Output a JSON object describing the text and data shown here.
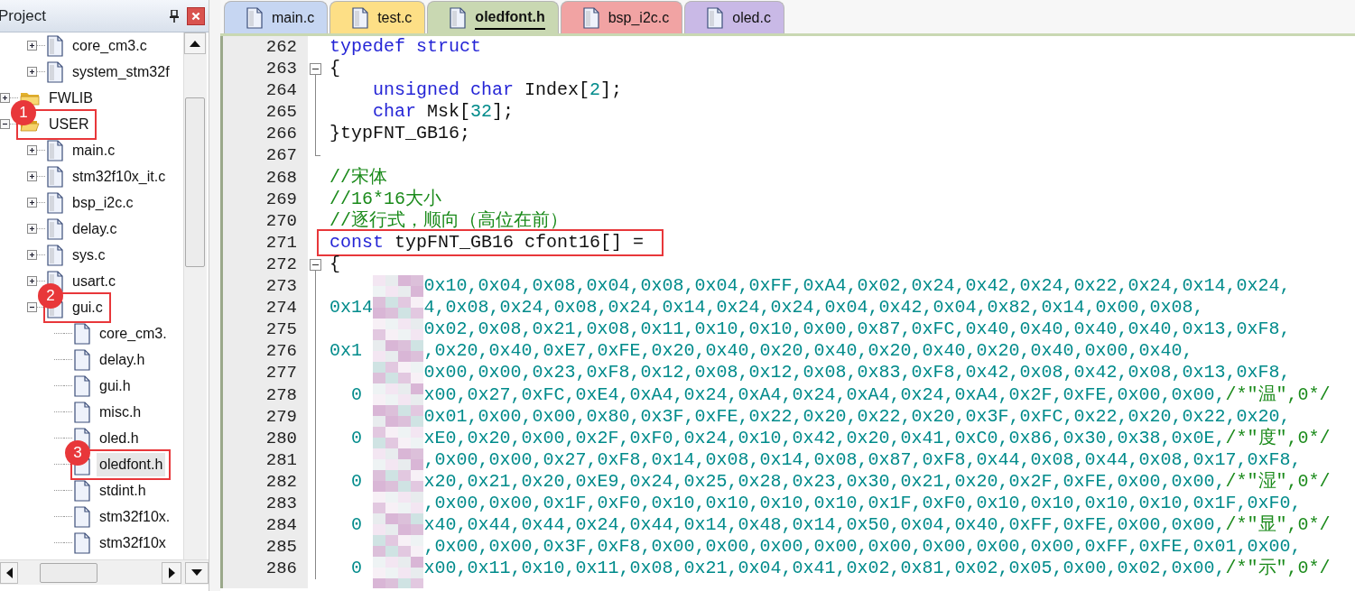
{
  "panel": {
    "title": "Project"
  },
  "tree": [
    {
      "children": [
        {
          "name": "core_cm3.c",
          "kind": "source",
          "expanded": false,
          "selected": false,
          "highlighted": false
        },
        {
          "name": "system_stm32f",
          "kind": "source",
          "expanded": false,
          "selected": false,
          "highlighted": false
        }
      ]
    },
    {
      "name": "FWLIB",
      "kind": "folder",
      "expanded": false,
      "selected": false,
      "highlighted": false
    },
    {
      "name": "USER",
      "kind": "folder",
      "expanded": true,
      "selected": false,
      "highlighted": true,
      "marker": "1",
      "children": [
        {
          "name": "main.c",
          "kind": "source",
          "expanded": false,
          "selected": false,
          "highlighted": false
        },
        {
          "name": "stm32f10x_it.c",
          "kind": "source",
          "expanded": false,
          "selected": false,
          "highlighted": false
        },
        {
          "name": "bsp_i2c.c",
          "kind": "source",
          "expanded": false,
          "selected": false,
          "highlighted": false
        },
        {
          "name": "delay.c",
          "kind": "source",
          "expanded": false,
          "selected": false,
          "highlighted": false
        },
        {
          "name": "sys.c",
          "kind": "source",
          "expanded": false,
          "selected": false,
          "highlighted": false
        },
        {
          "name": "usart.c",
          "kind": "source",
          "expanded": false,
          "selected": false,
          "highlighted": false
        },
        {
          "name": "gui.c",
          "kind": "source",
          "expanded": true,
          "selected": false,
          "highlighted": true,
          "marker": "2",
          "children": [
            {
              "name": "core_cm3.",
              "kind": "header",
              "selected": false,
              "highlighted": false
            },
            {
              "name": "delay.h",
              "kind": "header",
              "selected": false,
              "highlighted": false
            },
            {
              "name": "gui.h",
              "kind": "header",
              "selected": false,
              "highlighted": false
            },
            {
              "name": "misc.h",
              "kind": "header",
              "selected": false,
              "highlighted": false
            },
            {
              "name": "oled.h",
              "kind": "header",
              "selected": false,
              "highlighted": false
            },
            {
              "name": "oledfont.h",
              "kind": "header",
              "selected": true,
              "highlighted": true,
              "marker": "3"
            },
            {
              "name": "stdint.h",
              "kind": "header",
              "selected": false,
              "highlighted": false
            },
            {
              "name": "stm32f10x.",
              "kind": "header",
              "selected": false,
              "highlighted": false
            },
            {
              "name": "stm32f10x",
              "kind": "header",
              "selected": false,
              "highlighted": false
            }
          ]
        }
      ]
    }
  ],
  "tabs": [
    {
      "label": "main.c",
      "color": "#c6d6f2",
      "selected": false
    },
    {
      "label": "test.c",
      "color": "#fddf86",
      "selected": false
    },
    {
      "label": "oledfont.h",
      "color": "#c9d8b2",
      "selected": true
    },
    {
      "label": "bsp_i2c.c",
      "color": "#f1a3a3",
      "selected": false
    },
    {
      "label": "oled.c",
      "color": "#c9b9e6",
      "selected": false
    }
  ],
  "code_lines": [
    {
      "number": "262",
      "kind": "plain",
      "highlighted": false,
      "tokens": [
        {
          "kind": "keyword",
          "text": "typedef"
        },
        {
          "kind": "keyword",
          "text": " struct"
        }
      ]
    },
    {
      "number": "263",
      "kind": "opener",
      "highlighted": false,
      "tokens": [
        {
          "kind": "plain",
          "text": "{"
        }
      ]
    },
    {
      "number": "264",
      "kind": "body",
      "highlighted": false,
      "tokens": [
        {
          "kind": "keyword",
          "text": "    unsigned"
        },
        {
          "kind": "keyword",
          "text": " char"
        },
        {
          "kind": "plain",
          "text": " Index["
        },
        {
          "kind": "number",
          "text": "2"
        },
        {
          "kind": "plain",
          "text": "];"
        }
      ]
    },
    {
      "number": "265",
      "kind": "body",
      "highlighted": false,
      "tokens": [
        {
          "kind": "keyword",
          "text": "    char"
        },
        {
          "kind": "plain",
          "text": " Msk["
        },
        {
          "kind": "number",
          "text": "32"
        },
        {
          "kind": "plain",
          "text": "];"
        }
      ]
    },
    {
      "number": "266",
      "kind": "body",
      "highlighted": false,
      "tokens": [
        {
          "kind": "plain",
          "text": "}typFNT_GB16;"
        }
      ]
    },
    {
      "number": "267",
      "kind": "closer",
      "highlighted": false
    },
    {
      "number": "268",
      "kind": "plain",
      "highlighted": false,
      "tokens": [
        {
          "kind": "comment",
          "text": "//宋体"
        }
      ]
    },
    {
      "number": "269",
      "kind": "plain",
      "highlighted": false,
      "tokens": [
        {
          "kind": "comment",
          "text": "//16*16大小"
        }
      ]
    },
    {
      "number": "270",
      "kind": "plain",
      "highlighted": false,
      "tokens": [
        {
          "kind": "comment",
          "text": "//逐行式，顺向（高位在前）"
        }
      ]
    },
    {
      "number": "271",
      "kind": "plain",
      "highlighted": true,
      "tokens": [
        {
          "kind": "keyword",
          "text": "const"
        },
        {
          "kind": "plain",
          "text": " typFNT_GB16 cfont16[] ="
        }
      ]
    },
    {
      "number": "272",
      "kind": "opener",
      "highlighted": false,
      "tokens": [
        {
          "kind": "plain",
          "text": "{"
        }
      ]
    },
    {
      "number": "273",
      "kind": "body",
      "highlighted": false,
      "tokens": [
        {
          "kind": "redacted"
        },
        {
          "kind": "number",
          "text": "0x10,0x04,0x08,0x04,0x08,0x04,0xFF,0xA4,0x02,0x24,0x42,0x24,0x22,0x24,0x14,0x24,"
        }
      ]
    },
    {
      "number": "274",
      "kind": "body",
      "highlighted": false,
      "tokens": [
        {
          "kind": "number",
          "text": "0x14"
        },
        {
          "kind": "redacted"
        },
        {
          "kind": "number",
          "text": "4,0x08,0x24,0x08,0x24,0x14,0x24,0x24,0x04,0x42,0x04,0x82,0x14,0x00,0x08,"
        }
      ]
    },
    {
      "number": "275",
      "kind": "body",
      "highlighted": false,
      "tokens": [
        {
          "kind": "redacted"
        },
        {
          "kind": "number",
          "text": "0x02,0x08,0x21,0x08,0x11,0x10,0x10,0x00,0x87,0xFC,0x40,0x40,0x40,0x40,0x13,0xF8,"
        }
      ]
    },
    {
      "number": "276",
      "kind": "body",
      "highlighted": false,
      "tokens": [
        {
          "kind": "number",
          "text": "0x1"
        },
        {
          "kind": "redacted"
        },
        {
          "kind": "number",
          "text": ",0x20,0x40,0xE7,0xFE,0x20,0x40,0x20,0x40,0x20,0x40,0x20,0x40,0x00,0x40,"
        }
      ]
    },
    {
      "number": "277",
      "kind": "body",
      "highlighted": false,
      "tokens": [
        {
          "kind": "redacted"
        },
        {
          "kind": "number",
          "text": "0x00,0x00,0x23,0xF8,0x12,0x08,0x12,0x08,0x83,0xF8,0x42,0x08,0x42,0x08,0x13,0xF8,"
        }
      ]
    },
    {
      "number": "278",
      "kind": "body",
      "highlighted": false,
      "tokens": [
        {
          "kind": "number",
          "text": "  0"
        },
        {
          "kind": "redacted"
        },
        {
          "kind": "number",
          "text": "x00,0x27,0xFC,0xE4,0xA4,0x24,0xA4,0x24,0xA4,0x24,0xA4,0x2F,0xFE,0x00,0x00,"
        },
        {
          "kind": "comment",
          "text": "/*\"温\",0*/"
        }
      ]
    },
    {
      "number": "279",
      "kind": "body",
      "highlighted": false,
      "tokens": [
        {
          "kind": "redacted"
        },
        {
          "kind": "number",
          "text": "0x01,0x00,0x00,0x80,0x3F,0xFE,0x22,0x20,0x22,0x20,0x3F,0xFC,0x22,0x20,0x22,0x20,"
        }
      ]
    },
    {
      "number": "280",
      "kind": "body",
      "highlighted": false,
      "tokens": [
        {
          "kind": "number",
          "text": "  0"
        },
        {
          "kind": "redacted"
        },
        {
          "kind": "number",
          "text": "xE0,0x20,0x00,0x2F,0xF0,0x24,0x10,0x42,0x20,0x41,0xC0,0x86,0x30,0x38,0x0E,"
        },
        {
          "kind": "comment",
          "text": "/*\"度\",0*/"
        }
      ]
    },
    {
      "number": "281",
      "kind": "body",
      "highlighted": false,
      "tokens": [
        {
          "kind": "redacted"
        },
        {
          "kind": "number",
          "text": ",0x00,0x00,0x27,0xF8,0x14,0x08,0x14,0x08,0x87,0xF8,0x44,0x08,0x44,0x08,0x17,0xF8,"
        }
      ]
    },
    {
      "number": "282",
      "kind": "body",
      "highlighted": false,
      "tokens": [
        {
          "kind": "number",
          "text": "  0"
        },
        {
          "kind": "redacted"
        },
        {
          "kind": "number",
          "text": "x20,0x21,0x20,0xE9,0x24,0x25,0x28,0x23,0x30,0x21,0x20,0x2F,0xFE,0x00,0x00,"
        },
        {
          "kind": "comment",
          "text": "/*\"湿\",0*/"
        }
      ]
    },
    {
      "number": "283",
      "kind": "body",
      "highlighted": false,
      "tokens": [
        {
          "kind": "redacted"
        },
        {
          "kind": "number",
          "text": ",0x00,0x00,0x1F,0xF0,0x10,0x10,0x10,0x10,0x1F,0xF0,0x10,0x10,0x10,0x10,0x1F,0xF0,"
        }
      ]
    },
    {
      "number": "284",
      "kind": "body",
      "highlighted": false,
      "tokens": [
        {
          "kind": "number",
          "text": "  0"
        },
        {
          "kind": "redacted"
        },
        {
          "kind": "number",
          "text": "x40,0x44,0x44,0x24,0x44,0x14,0x48,0x14,0x50,0x04,0x40,0xFF,0xFE,0x00,0x00,"
        },
        {
          "kind": "comment",
          "text": "/*\"显\",0*/"
        }
      ]
    },
    {
      "number": "285",
      "kind": "body",
      "highlighted": false,
      "tokens": [
        {
          "kind": "redacted"
        },
        {
          "kind": "number",
          "text": ",0x00,0x00,0x3F,0xF8,0x00,0x00,0x00,0x00,0x00,0x00,0x00,0x00,0xFF,0xFE,0x01,0x00,"
        }
      ]
    },
    {
      "number": "286",
      "kind": "body",
      "highlighted": false,
      "tokens": [
        {
          "kind": "number",
          "text": "  0"
        },
        {
          "kind": "redacted"
        },
        {
          "kind": "number",
          "text": "x00,0x11,0x10,0x11,0x08,0x21,0x04,0x41,0x02,0x81,0x02,0x05,0x00,0x02,0x00,"
        },
        {
          "kind": "comment",
          "text": "/*\"示\",0*/"
        }
      ]
    }
  ]
}
